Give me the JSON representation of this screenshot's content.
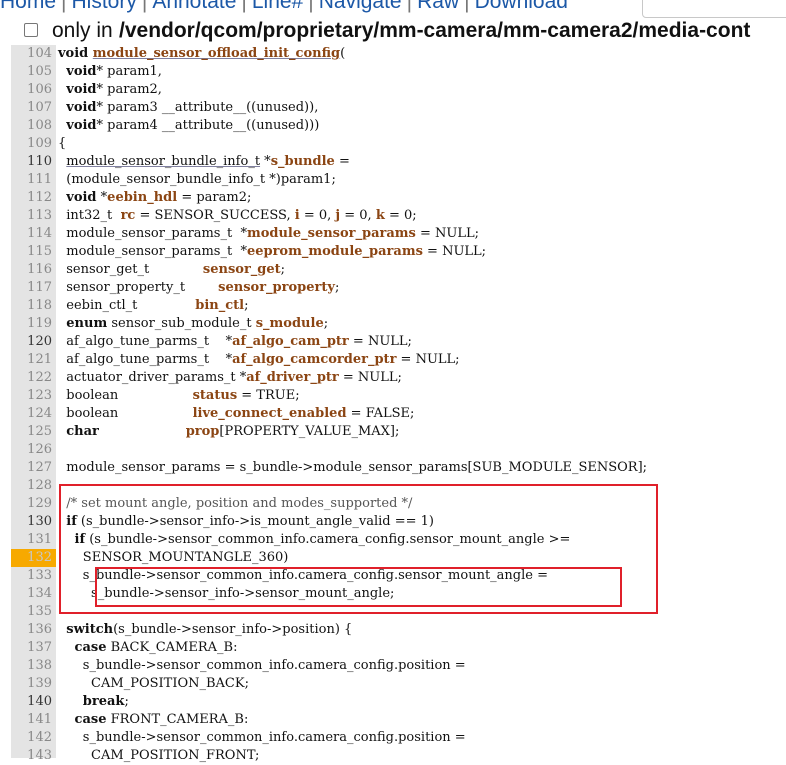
{
  "nav": {
    "links": [
      "Home",
      "History",
      "Annotate",
      "Line#",
      "Navigate",
      "Raw",
      "Download"
    ],
    "separator": "|"
  },
  "path_bar": {
    "checkbox_checked": false,
    "only_label": "only in",
    "path": "/vendor/qcom/proprietary/mm-camera/mm-camera2/media-cont"
  },
  "highlight_color": "#f7a900",
  "annotation_color": "#e0202a",
  "code_lines": [
    {
      "n": "104",
      "segs": [
        [
          "k",
          "void "
        ],
        [
          "fu",
          "module_sensor_offload_init_config"
        ],
        [
          "",
          "("
        ]
      ]
    },
    {
      "n": "105",
      "segs": [
        [
          "",
          "  "
        ],
        [
          "k",
          "void"
        ],
        [
          "",
          "* param1,"
        ]
      ]
    },
    {
      "n": "106",
      "segs": [
        [
          "",
          "  "
        ],
        [
          "k",
          "void"
        ],
        [
          "",
          "* param2,"
        ]
      ]
    },
    {
      "n": "107",
      "segs": [
        [
          "",
          "  "
        ],
        [
          "k",
          "void"
        ],
        [
          "",
          "* param3 __attribute__((unused)),"
        ]
      ]
    },
    {
      "n": "108",
      "segs": [
        [
          "",
          "  "
        ],
        [
          "k",
          "void"
        ],
        [
          "",
          "* param4 __attribute__((unused)))"
        ]
      ]
    },
    {
      "n": "109",
      "segs": [
        [
          "",
          "{"
        ]
      ]
    },
    {
      "n": "110",
      "b": true,
      "segs": [
        [
          "",
          "  "
        ],
        [
          "u",
          "module_sensor_bundle_info_t"
        ],
        [
          "",
          " *"
        ],
        [
          "f",
          "s_bundle"
        ],
        [
          "",
          " ="
        ]
      ]
    },
    {
      "n": "111",
      "segs": [
        [
          "",
          "  (module_sensor_bundle_info_t *)param1;"
        ]
      ]
    },
    {
      "n": "112",
      "segs": [
        [
          "",
          "  "
        ],
        [
          "k",
          "void"
        ],
        [
          "",
          " *"
        ],
        [
          "f",
          "eebin_hdl"
        ],
        [
          "",
          " = param2;"
        ]
      ]
    },
    {
      "n": "113",
      "segs": [
        [
          "",
          "  int32_t  "
        ],
        [
          "f",
          "rc"
        ],
        [
          "",
          " = SENSOR_SUCCESS, "
        ],
        [
          "f",
          "i"
        ],
        [
          "",
          " = 0, "
        ],
        [
          "f",
          "j"
        ],
        [
          "",
          " = 0, "
        ],
        [
          "f",
          "k"
        ],
        [
          "",
          " = 0;"
        ]
      ]
    },
    {
      "n": "114",
      "segs": [
        [
          "",
          "  module_sensor_params_t  *"
        ],
        [
          "f",
          "module_sensor_params"
        ],
        [
          "",
          " = NULL;"
        ]
      ]
    },
    {
      "n": "115",
      "segs": [
        [
          "",
          "  module_sensor_params_t  *"
        ],
        [
          "f",
          "eeprom_module_params"
        ],
        [
          "",
          " = NULL;"
        ]
      ]
    },
    {
      "n": "116",
      "segs": [
        [
          "",
          "  sensor_get_t             "
        ],
        [
          "f",
          "sensor_get"
        ],
        [
          "",
          ";"
        ]
      ]
    },
    {
      "n": "117",
      "segs": [
        [
          "",
          "  sensor_property_t        "
        ],
        [
          "f",
          "sensor_property"
        ],
        [
          "",
          ";"
        ]
      ]
    },
    {
      "n": "118",
      "segs": [
        [
          "",
          "  eebin_ctl_t              "
        ],
        [
          "f",
          "bin_ctl"
        ],
        [
          "",
          ";"
        ]
      ]
    },
    {
      "n": "119",
      "segs": [
        [
          "",
          "  "
        ],
        [
          "k",
          "enum"
        ],
        [
          "",
          " sensor_sub_module_t "
        ],
        [
          "f",
          "s_module"
        ],
        [
          "",
          ";"
        ]
      ]
    },
    {
      "n": "120",
      "b": true,
      "segs": [
        [
          "",
          "  af_algo_tune_parms_t    *"
        ],
        [
          "f",
          "af_algo_cam_ptr"
        ],
        [
          "",
          " = NULL;"
        ]
      ]
    },
    {
      "n": "121",
      "segs": [
        [
          "",
          "  af_algo_tune_parms_t    *"
        ],
        [
          "f",
          "af_algo_camcorder_ptr"
        ],
        [
          "",
          " = NULL;"
        ]
      ]
    },
    {
      "n": "122",
      "segs": [
        [
          "",
          "  actuator_driver_params_t *"
        ],
        [
          "f",
          "af_driver_ptr"
        ],
        [
          "",
          " = NULL;"
        ]
      ]
    },
    {
      "n": "123",
      "segs": [
        [
          "",
          "  boolean                  "
        ],
        [
          "f",
          "status"
        ],
        [
          "",
          " = TRUE;"
        ]
      ]
    },
    {
      "n": "124",
      "segs": [
        [
          "",
          "  boolean                  "
        ],
        [
          "f",
          "live_connect_enabled"
        ],
        [
          "",
          " = FALSE;"
        ]
      ]
    },
    {
      "n": "125",
      "segs": [
        [
          "",
          "  "
        ],
        [
          "k",
          "char"
        ],
        [
          "",
          "                     "
        ],
        [
          "f",
          "prop"
        ],
        [
          "",
          "[PROPERTY_VALUE_MAX];"
        ]
      ]
    },
    {
      "n": "126",
      "segs": []
    },
    {
      "n": "127",
      "segs": [
        [
          "",
          "  module_sensor_params = s_bundle->module_sensor_params[SUB_MODULE_SENSOR];"
        ]
      ]
    },
    {
      "n": "128",
      "segs": []
    },
    {
      "n": "129",
      "segs": [
        [
          "",
          "  "
        ],
        [
          "c",
          "/* set mount angle, position and modes_supported */"
        ]
      ]
    },
    {
      "n": "130",
      "b": true,
      "segs": [
        [
          "",
          "  "
        ],
        [
          "k",
          "if"
        ],
        [
          "",
          " (s_bundle->sensor_info->is_mount_angle_valid == 1)"
        ]
      ]
    },
    {
      "n": "131",
      "segs": [
        [
          "",
          "    "
        ],
        [
          "k",
          "if"
        ],
        [
          "",
          " (s_bundle->sensor_common_info.camera_config.sensor_mount_angle >="
        ]
      ]
    },
    {
      "n": "132",
      "hl": true,
      "segs": [
        [
          "",
          "      SENSOR_MOUNTANGLE_360)"
        ]
      ]
    },
    {
      "n": "133",
      "segs": [
        [
          "",
          "      s_bundle->sensor_common_info.camera_config.sensor_mount_angle ="
        ]
      ]
    },
    {
      "n": "134",
      "segs": [
        [
          "",
          "        s_bundle->sensor_info->sensor_mount_angle;"
        ]
      ]
    },
    {
      "n": "135",
      "segs": []
    },
    {
      "n": "136",
      "segs": [
        [
          "",
          "  "
        ],
        [
          "k",
          "switch"
        ],
        [
          "",
          "(s_bundle->sensor_info->position) {"
        ]
      ]
    },
    {
      "n": "137",
      "segs": [
        [
          "",
          "    "
        ],
        [
          "k",
          "case"
        ],
        [
          "",
          " BACK_CAMERA_B:"
        ]
      ]
    },
    {
      "n": "138",
      "segs": [
        [
          "",
          "      s_bundle->sensor_common_info.camera_config.position ="
        ]
      ]
    },
    {
      "n": "139",
      "segs": [
        [
          "",
          "        CAM_POSITION_BACK;"
        ]
      ]
    },
    {
      "n": "140",
      "b": true,
      "segs": [
        [
          "",
          "      "
        ],
        [
          "k",
          "break"
        ],
        [
          "",
          ";"
        ]
      ]
    },
    {
      "n": "141",
      "segs": [
        [
          "",
          "    "
        ],
        [
          "k",
          "case"
        ],
        [
          "",
          " FRONT_CAMERA_B:"
        ]
      ]
    },
    {
      "n": "142",
      "segs": [
        [
          "",
          "      s_bundle->sensor_common_info.camera_config.position ="
        ]
      ]
    },
    {
      "n": "143",
      "segs": [
        [
          "",
          "        CAM_POSITION_FRONT;"
        ]
      ]
    }
  ]
}
